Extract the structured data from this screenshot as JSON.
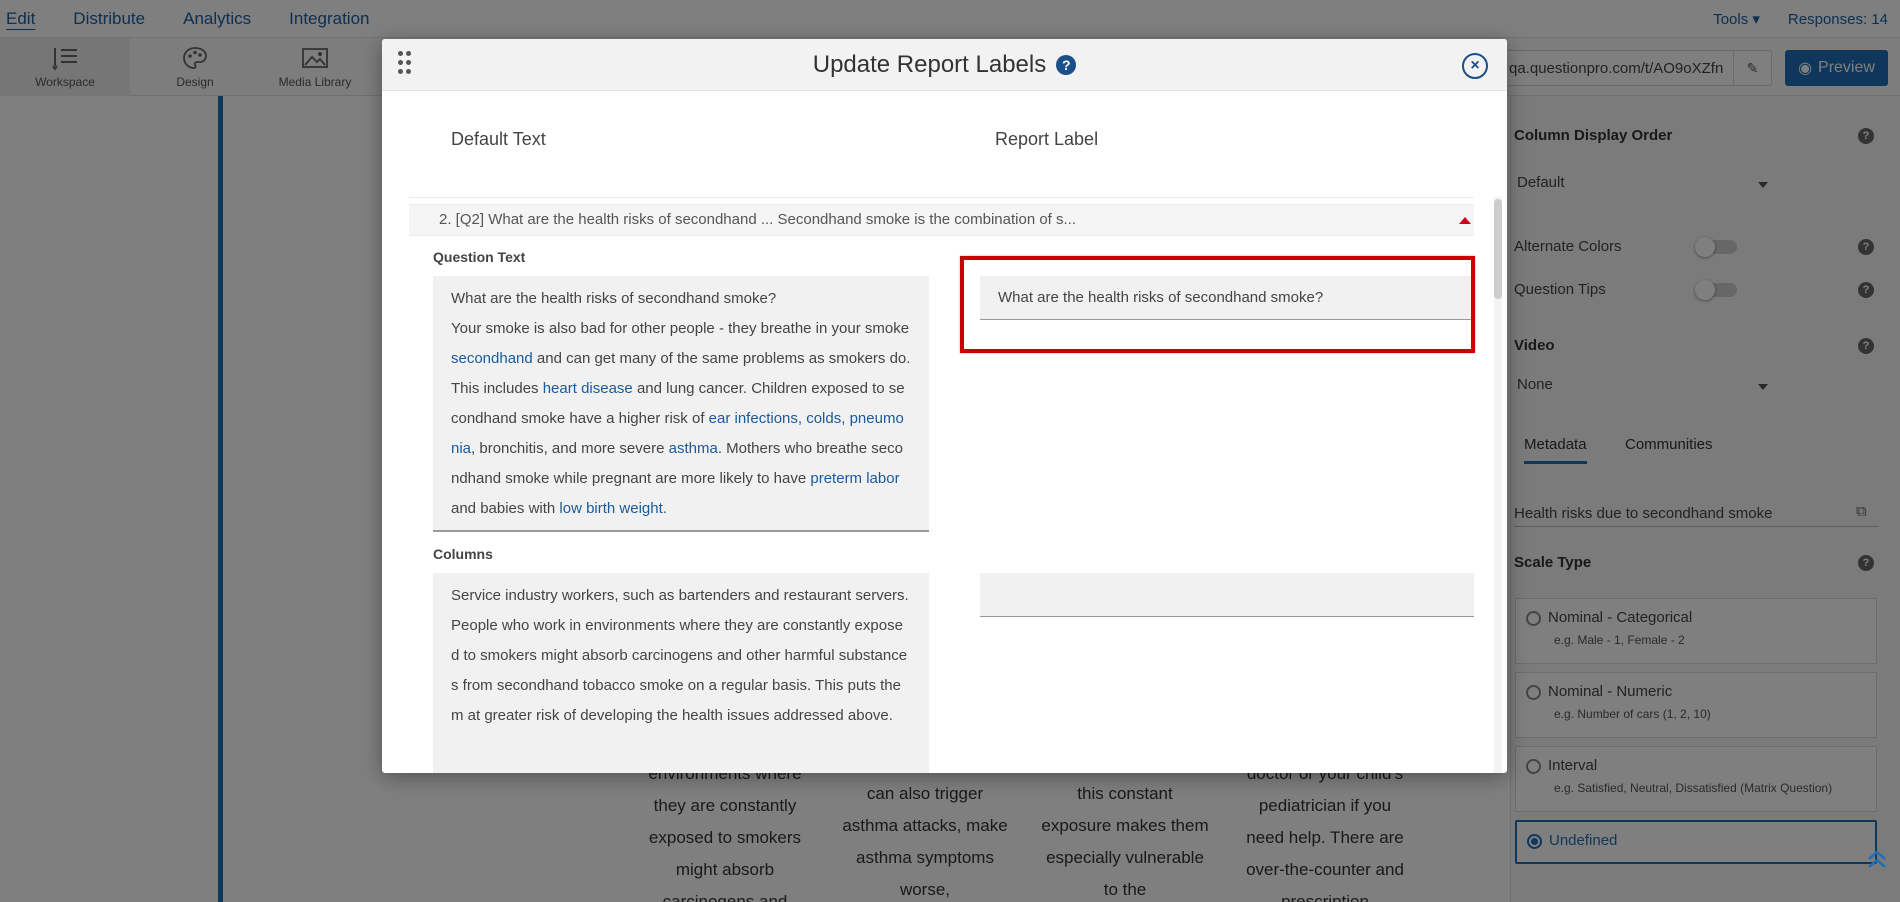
{
  "topnav": {
    "items": [
      "Edit",
      "Distribute",
      "Analytics",
      "Integration"
    ],
    "tools_label": "Tools",
    "responses_label": "Responses: 14"
  },
  "toolbar": {
    "workspace": "Workspace",
    "design": "Design",
    "media_library": "Media Library",
    "survey_url": "qa.questionpro.com/t/AO9oXZfn",
    "preview": "Preview"
  },
  "sidebar": {
    "column_display_order": "Column Display Order",
    "column_display_value": "Default",
    "alternate_colors": "Alternate Colors",
    "question_tips": "Question Tips",
    "video": "Video",
    "video_value": "None",
    "tabs": [
      "Metadata",
      "Communities"
    ],
    "metadata_value": "Health risks due to secondhand smoke",
    "scale_type": "Scale Type",
    "scale_options": [
      {
        "title": "Nominal - Categorical",
        "sub": "e.g. Male - 1, Female - 2"
      },
      {
        "title": "Nominal - Numeric",
        "sub": "e.g. Number of cars (1, 2, 10)"
      },
      {
        "title": "Interval",
        "sub": "e.g. Satisfied, Neutral, Dissatisfied (Matrix Question)"
      },
      {
        "title": "Undefined",
        "sub": ""
      }
    ]
  },
  "background_columns": [
    "environments where they are constantly exposed to smokers might absorb carcinogens and",
    "can also trigger asthma attacks, make asthma symptoms worse,",
    "this constant exposure makes them especially vulnerable to the",
    "doctor or your child's pediatrician if you need help. There are over-the-counter and prescription"
  ],
  "modal": {
    "title": "Update Report Labels",
    "help_glyph": "?",
    "close_glyph": "×",
    "col_default": "Default Text",
    "col_report": "Report Label",
    "accordion_title": "2. [Q2] What are the health risks of secondhand ... Secondhand smoke is the combination of s...",
    "question_text_label": "Question Text",
    "question_default_parts": {
      "line1": "What are the health risks of secondhand smoke?",
      "p1": "Your smoke is also bad for other people - they breathe in your smoke ",
      "l1": "secondhand",
      "p2": " and can get many of the same problems as smokers do. This includes ",
      "l2": "heart disease",
      "p3": " and lung cancer. Children exposed to secondhand smoke have a higher risk of ",
      "l3": "ear infections",
      "p4": ", ",
      "l4": "colds",
      "p5": ", ",
      "l5": "pneumonia",
      "p6": ", bronchitis, and more severe ",
      "l6": "asthma",
      "p7": ". Mothers who breathe secondhand smoke while pregnant are more likely to have ",
      "l7": "preterm labor",
      "p8": " and babies with ",
      "l8": "low birth weight",
      "p9": "."
    },
    "question_report_value": "What are the health risks of secondhand smoke?",
    "columns_label": "Columns",
    "columns_default": "Service industry workers, such as bartenders and restaurant servers. People who work in environments where they are constantly exposed to smokers might absorb carcinogens and other harmful substances from secondhand tobacco smoke on a regular basis. This puts them at greater risk of developing the health issues addressed above.",
    "columns_report_value": ""
  }
}
